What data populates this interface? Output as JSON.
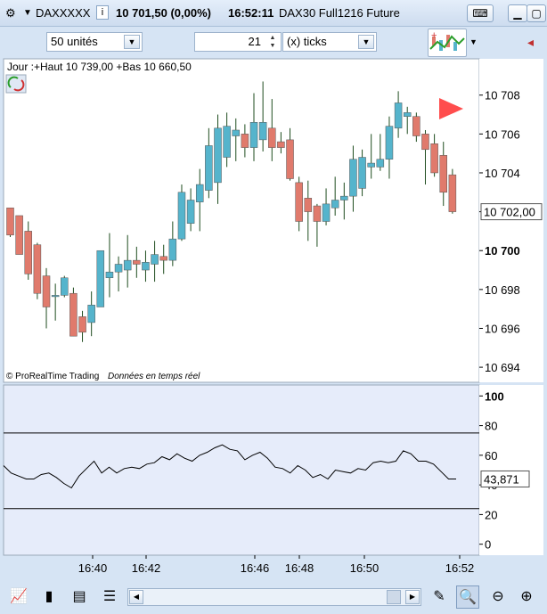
{
  "titlebar": {
    "instrument": "DAXXXXX",
    "info": "10 701,50 (0,00%)",
    "time": "16:52:11",
    "contract": "DAX30 Full1216 Future",
    "ix": "i"
  },
  "toolbar": {
    "units_value": "50 unités",
    "ticks_count": "21",
    "ticks_unit": "(x) ticks"
  },
  "legend": {
    "text": "Jour :+Haut 10 739,00 +Bas 10 660,50"
  },
  "credit": {
    "brand": "© ProRealTime Trading",
    "feed": "Données en temps réel"
  },
  "colors": {
    "up": "#55b4cc",
    "down": "#e07a6c",
    "wick": "#1f4d1f",
    "grid_bg": "#ffffff",
    "osc_bg": "#e6ecfa",
    "accent_arrow": "#ff4d4d"
  },
  "chart_data": [
    {
      "type": "candlestick",
      "x_labels": [
        "16:40",
        "16:42",
        "16:46",
        "16:48",
        "16:50",
        "16:52"
      ],
      "y_ticks": [
        "10 708",
        "10 706",
        "10 704",
        "10 702,00",
        "10 700",
        "10 698",
        "10 696",
        "10 694"
      ],
      "last_price_label": "10 702,00",
      "ylim": [
        10693.5,
        10709.5
      ],
      "candles": [
        {
          "o": 10702.2,
          "h": 10702.2,
          "l": 10700.7,
          "c": 10700.8
        },
        {
          "o": 10701.8,
          "h": 10701.8,
          "l": 10699.8,
          "c": 10699.8
        },
        {
          "o": 10701.0,
          "h": 10701.5,
          "l": 10698.5,
          "c": 10698.8
        },
        {
          "o": 10700.3,
          "h": 10700.4,
          "l": 10697.5,
          "c": 10697.8
        },
        {
          "o": 10698.7,
          "h": 10699.1,
          "l": 10696.0,
          "c": 10697.1
        },
        {
          "o": 10697.7,
          "h": 10698.3,
          "l": 10696.4,
          "c": 10697.7
        },
        {
          "o": 10697.7,
          "h": 10698.7,
          "l": 10697.6,
          "c": 10698.6
        },
        {
          "o": 10697.8,
          "h": 10698.1,
          "l": 10695.6,
          "c": 10695.6
        },
        {
          "o": 10696.6,
          "h": 10696.9,
          "l": 10695.3,
          "c": 10695.8
        },
        {
          "o": 10696.3,
          "h": 10697.9,
          "l": 10695.6,
          "c": 10697.2
        },
        {
          "o": 10697.1,
          "h": 10700.0,
          "l": 10697.1,
          "c": 10700.0
        },
        {
          "o": 10698.6,
          "h": 10700.9,
          "l": 10697.6,
          "c": 10698.9
        },
        {
          "o": 10698.9,
          "h": 10699.7,
          "l": 10697.9,
          "c": 10699.3
        },
        {
          "o": 10699.0,
          "h": 10700.8,
          "l": 10698.1,
          "c": 10699.5
        },
        {
          "o": 10699.5,
          "h": 10700.2,
          "l": 10698.6,
          "c": 10699.3
        },
        {
          "o": 10699.0,
          "h": 10700.0,
          "l": 10698.4,
          "c": 10699.4
        },
        {
          "o": 10699.3,
          "h": 10700.5,
          "l": 10698.4,
          "c": 10699.8
        },
        {
          "o": 10699.7,
          "h": 10700.3,
          "l": 10698.8,
          "c": 10699.5
        },
        {
          "o": 10699.5,
          "h": 10701.5,
          "l": 10699.2,
          "c": 10700.6
        },
        {
          "o": 10700.6,
          "h": 10703.4,
          "l": 10700.5,
          "c": 10703.0
        },
        {
          "o": 10701.4,
          "h": 10703.2,
          "l": 10701.0,
          "c": 10702.6
        },
        {
          "o": 10702.5,
          "h": 10704.2,
          "l": 10701.0,
          "c": 10703.4
        },
        {
          "o": 10703.1,
          "h": 10706.3,
          "l": 10702.7,
          "c": 10705.4
        },
        {
          "o": 10703.5,
          "h": 10707.0,
          "l": 10702.4,
          "c": 10706.3
        },
        {
          "o": 10704.8,
          "h": 10707.1,
          "l": 10704.3,
          "c": 10706.4
        },
        {
          "o": 10705.9,
          "h": 10706.8,
          "l": 10704.6,
          "c": 10706.2
        },
        {
          "o": 10706.0,
          "h": 10706.5,
          "l": 10704.8,
          "c": 10705.3
        },
        {
          "o": 10705.3,
          "h": 10708.1,
          "l": 10704.6,
          "c": 10706.6
        },
        {
          "o": 10705.7,
          "h": 10708.7,
          "l": 10705.1,
          "c": 10706.6
        },
        {
          "o": 10706.3,
          "h": 10707.8,
          "l": 10704.6,
          "c": 10705.3
        },
        {
          "o": 10705.6,
          "h": 10706.1,
          "l": 10705.0,
          "c": 10705.3
        },
        {
          "o": 10705.7,
          "h": 10706.3,
          "l": 10703.6,
          "c": 10703.7
        },
        {
          "o": 10703.5,
          "h": 10703.8,
          "l": 10701.0,
          "c": 10701.5
        },
        {
          "o": 10702.7,
          "h": 10703.6,
          "l": 10700.5,
          "c": 10702.0
        },
        {
          "o": 10702.3,
          "h": 10702.4,
          "l": 10700.2,
          "c": 10701.5
        },
        {
          "o": 10701.5,
          "h": 10703.2,
          "l": 10701.3,
          "c": 10702.4
        },
        {
          "o": 10702.2,
          "h": 10703.8,
          "l": 10701.8,
          "c": 10702.6
        },
        {
          "o": 10702.6,
          "h": 10703.5,
          "l": 10701.6,
          "c": 10702.8
        },
        {
          "o": 10702.8,
          "h": 10705.4,
          "l": 10702.0,
          "c": 10704.7
        },
        {
          "o": 10703.2,
          "h": 10705.2,
          "l": 10702.8,
          "c": 10704.8
        },
        {
          "o": 10704.3,
          "h": 10706.0,
          "l": 10703.7,
          "c": 10704.5
        },
        {
          "o": 10704.3,
          "h": 10706.0,
          "l": 10704.1,
          "c": 10704.7
        },
        {
          "o": 10704.7,
          "h": 10706.9,
          "l": 10703.7,
          "c": 10706.4
        },
        {
          "o": 10706.3,
          "h": 10708.2,
          "l": 10705.8,
          "c": 10707.6
        },
        {
          "o": 10706.9,
          "h": 10707.4,
          "l": 10706.0,
          "c": 10707.1
        },
        {
          "o": 10706.9,
          "h": 10707.1,
          "l": 10705.6,
          "c": 10705.9
        },
        {
          "o": 10706.0,
          "h": 10706.2,
          "l": 10703.4,
          "c": 10705.2
        },
        {
          "o": 10705.5,
          "h": 10706.0,
          "l": 10703.8,
          "c": 10704.0
        },
        {
          "o": 10704.9,
          "h": 10705.6,
          "l": 10702.3,
          "c": 10703.0
        },
        {
          "o": 10703.9,
          "h": 10704.2,
          "l": 10701.9,
          "c": 10702.0
        }
      ]
    },
    {
      "type": "line",
      "y_ticks": [
        "100",
        "80",
        "60",
        "40",
        "20",
        "0"
      ],
      "ylim": [
        -5,
        105
      ],
      "upper_level": 75,
      "lower_level": 24,
      "last_value_label": "43,871",
      "values": [
        53,
        48,
        46,
        44,
        44,
        47,
        48,
        45,
        41,
        38,
        46,
        51,
        56,
        48,
        52,
        48,
        51,
        52,
        51,
        54,
        55,
        59,
        57,
        61,
        58,
        56,
        60,
        62,
        65,
        67,
        64,
        63,
        57,
        60,
        62,
        58,
        52,
        51,
        48,
        53,
        50,
        45,
        47,
        44,
        50,
        49,
        48,
        51,
        50,
        55,
        56,
        55,
        56,
        63,
        61,
        56,
        56,
        54,
        49,
        44,
        44
      ]
    }
  ]
}
